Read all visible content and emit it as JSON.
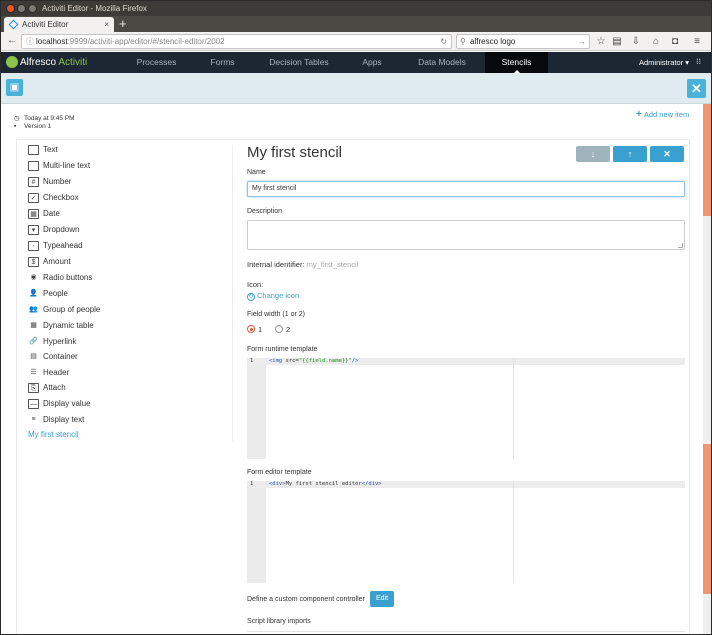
{
  "window": {
    "title": "Activiti Editor - Mozilla Firefox"
  },
  "browser": {
    "tab_title": "Activiti Editor",
    "url_host": "localhost",
    "url_path": ":9999/activiti-app/editor/#/stencil-editor/2002",
    "search_value": "alfresco logo"
  },
  "app": {
    "logo_brand": "Alfresco",
    "logo_product": "Activiti",
    "menu": [
      {
        "label": "Processes"
      },
      {
        "label": "Forms"
      },
      {
        "label": "Decision Tables"
      },
      {
        "label": "Apps"
      },
      {
        "label": "Data Models"
      },
      {
        "label": "Stencils",
        "active": true
      }
    ],
    "user": "Administrator"
  },
  "meta": {
    "modified": "Today at 9:45 PM",
    "version": "Version 1"
  },
  "add_new_item": "Add new item",
  "palette": [
    {
      "label": "Text",
      "icon": "text-icon"
    },
    {
      "label": "Multi-line text",
      "icon": "multiline-text-icon"
    },
    {
      "label": "Number",
      "icon": "number-icon"
    },
    {
      "label": "Checkbox",
      "icon": "checkbox-icon"
    },
    {
      "label": "Date",
      "icon": "date-icon"
    },
    {
      "label": "Dropdown",
      "icon": "dropdown-icon"
    },
    {
      "label": "Typeahead",
      "icon": "typeahead-icon"
    },
    {
      "label": "Amount",
      "icon": "amount-icon"
    },
    {
      "label": "Radio buttons",
      "icon": "radio-buttons-icon"
    },
    {
      "label": "People",
      "icon": "people-icon"
    },
    {
      "label": "Group of people",
      "icon": "group-of-people-icon"
    },
    {
      "label": "Dynamic table",
      "icon": "dynamic-table-icon"
    },
    {
      "label": "Hyperlink",
      "icon": "hyperlink-icon"
    },
    {
      "label": "Container",
      "icon": "container-icon"
    },
    {
      "label": "Header",
      "icon": "header-icon"
    },
    {
      "label": "Attach",
      "icon": "attach-icon"
    },
    {
      "label": "Display value",
      "icon": "display-value-icon"
    },
    {
      "label": "Display text",
      "icon": "display-text-icon"
    }
  ],
  "palette_custom": "My first stencil",
  "form": {
    "heading": "My first stencil",
    "name_label": "Name",
    "name_value": "My first stencil",
    "description_label": "Description",
    "description_value": "",
    "identifier_label": "Internal identifier:",
    "identifier_value": "my_first_stencil",
    "icon_label": "Icon:",
    "change_icon": "Change icon",
    "field_width_label": "Field width (1 or 2)",
    "width_options": [
      "1",
      "2"
    ],
    "width_selected": "1",
    "runtime_label": "Form runtime template",
    "runtime_line_no": "1",
    "editor_label": "Form editor template",
    "editor_line_no": "1",
    "controller_label": "Define a custom component controller",
    "edit_button": "Edit",
    "script_label": "Script library imports"
  },
  "colors": {
    "accent": "#4ab2d9",
    "header_bg": "#1c2733",
    "brand_green": "#8bc34a",
    "gray_button": "#9fb3bc",
    "radio_selected": "#e05b30"
  }
}
